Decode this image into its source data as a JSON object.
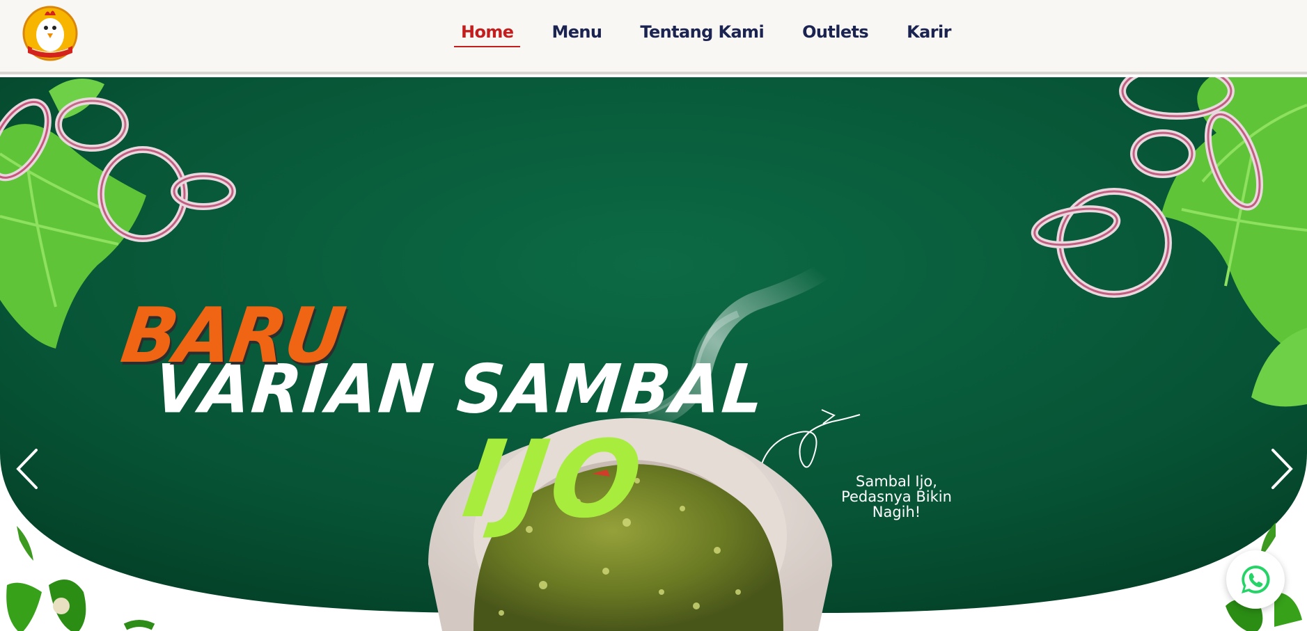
{
  "header": {
    "logo_alt": "Ayam Goreng Nelongso",
    "nav": [
      {
        "label": "Home",
        "active": true
      },
      {
        "label": "Menu",
        "active": false
      },
      {
        "label": "Tentang Kami",
        "active": false
      },
      {
        "label": "Outlets",
        "active": false
      },
      {
        "label": "Karir",
        "active": false
      }
    ]
  },
  "hero": {
    "badge": "BARU",
    "title_line": "VARIAN SAMBAL",
    "title_highlight": "IJO",
    "tagline": "Sambal Ijo, Pedasnya Bikin Nagih!"
  },
  "controls": {
    "prev_icon": "chevron-left-icon",
    "next_icon": "chevron-right-icon",
    "whatsapp_icon": "whatsapp-icon"
  },
  "colors": {
    "nav_text": "#1b2350",
    "nav_active": "#c31d1d",
    "hero_green": "#0b5a3a",
    "badge_orange": "#f06514",
    "ijo_green": "#a8ec3e",
    "whatsapp_green": "#25d366"
  }
}
